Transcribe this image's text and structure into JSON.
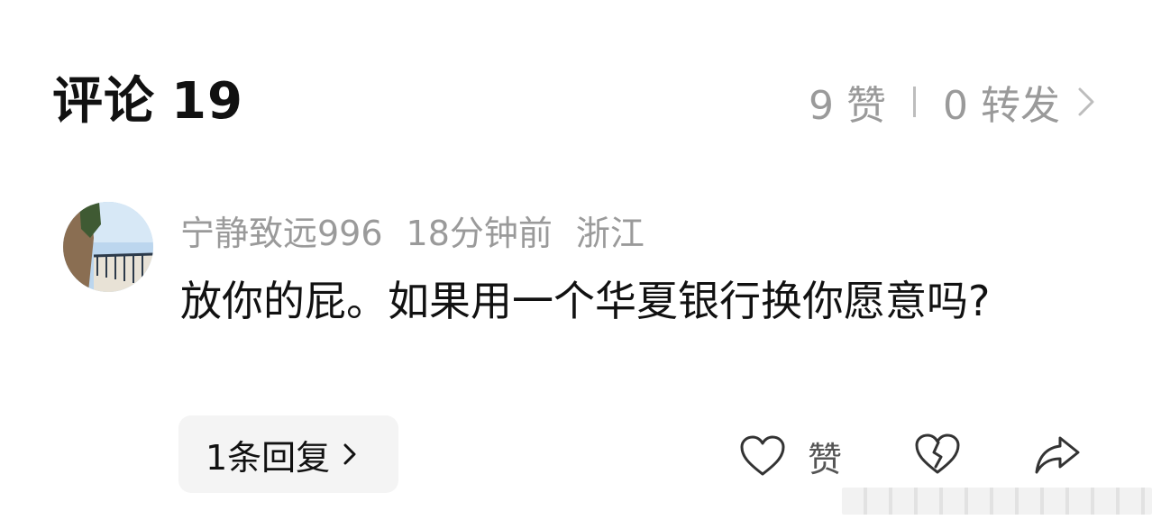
{
  "header": {
    "title": "评论",
    "comment_count": "19",
    "likes": "9 赞",
    "reposts": "0 转发"
  },
  "comment": {
    "username": "宁静致远996",
    "time": "18分钟前",
    "location": "浙江",
    "text": "放你的屁。如果用一个华夏银行换你愿意吗?",
    "reply_label": "1条回复",
    "like_label": "赞"
  },
  "icons": {
    "stats_chevron": "chevron-right-icon",
    "reply_chevron": "chevron-right-icon",
    "like": "heart-outline-icon",
    "dislike": "broken-heart-icon",
    "share": "share-arrow-icon"
  },
  "colors": {
    "text": "#111111",
    "muted": "#9a9a9a",
    "pill_bg": "#f4f4f4"
  }
}
